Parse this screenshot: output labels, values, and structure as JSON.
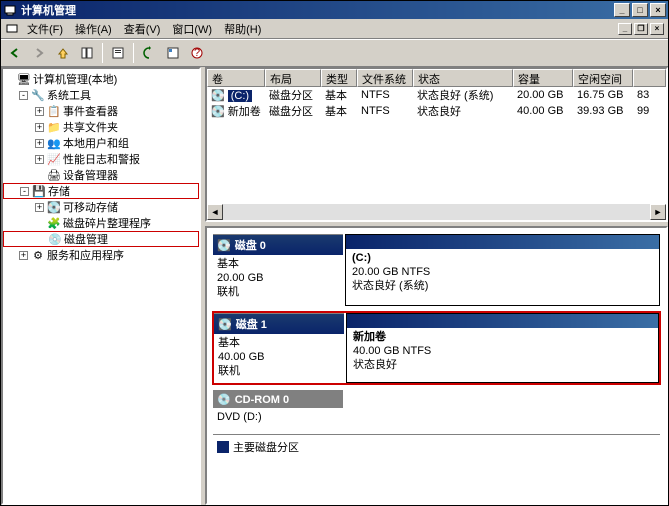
{
  "window": {
    "title": "计算机管理"
  },
  "menu": {
    "file": "文件(F)",
    "action": "操作(A)",
    "view": "查看(V)",
    "window2": "窗口(W)",
    "help": "帮助(H)"
  },
  "tree": {
    "root": "计算机管理(本地)",
    "systools": "系统工具",
    "eventviewer": "事件查看器",
    "sharedfolders": "共享文件夹",
    "localusers": "本地用户和组",
    "perflogs": "性能日志和警报",
    "devmgr": "设备管理器",
    "storage": "存储",
    "removable": "可移动存储",
    "defrag": "磁盘碎片整理程序",
    "diskmgmt": "磁盘管理",
    "services": "服务和应用程序"
  },
  "cols": {
    "volume": "卷",
    "layout": "布局",
    "type": "类型",
    "fs": "文件系统",
    "status": "状态",
    "capacity": "容量",
    "free": "空闲空间",
    "pct": ""
  },
  "rows": [
    {
      "vol": "(C:)",
      "layout": "磁盘分区",
      "type": "基本",
      "fs": "NTFS",
      "status": "状态良好 (系统)",
      "cap": "20.00 GB",
      "free": "16.75 GB",
      "pct": "83"
    },
    {
      "vol": "新加卷",
      "layout": "磁盘分区",
      "type": "基本",
      "fs": "NTFS",
      "status": "状态良好",
      "cap": "40.00 GB",
      "free": "39.93 GB",
      "pct": "99"
    }
  ],
  "disks": [
    {
      "name": "磁盘 0",
      "kind": "基本",
      "size": "20.00 GB",
      "state": "联机",
      "part": {
        "title": "(C:)",
        "l1": "20.00 GB NTFS",
        "l2": "状态良好 (系统)",
        "striped": true
      }
    },
    {
      "name": "磁盘 1",
      "kind": "基本",
      "size": "40.00 GB",
      "state": "联机",
      "part": {
        "title": "新加卷",
        "l1": "40.00 GB NTFS",
        "l2": "状态良好",
        "striped": false
      },
      "hl": true
    },
    {
      "name": "CD-ROM 0",
      "kind": "DVD (D:)",
      "size": "",
      "state": "",
      "cdrom": true
    }
  ],
  "legend": {
    "primary": "主要磁盘分区"
  }
}
